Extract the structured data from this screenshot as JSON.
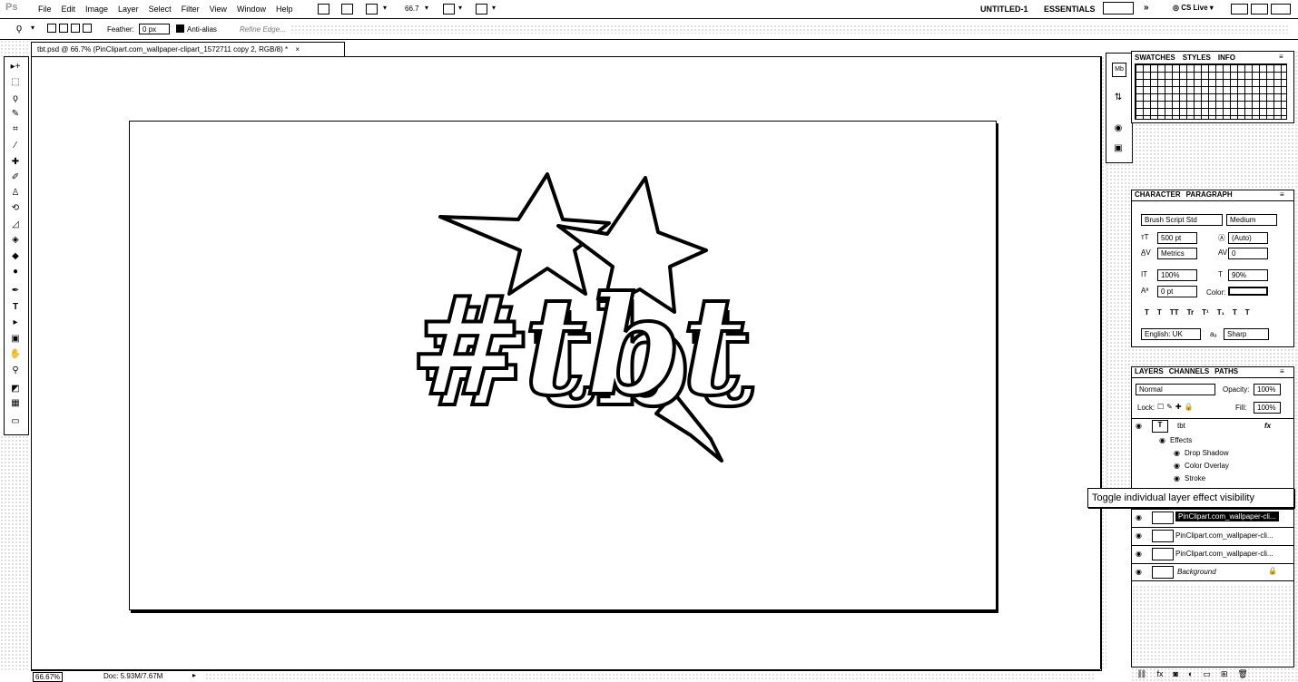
{
  "app": {
    "logo": "Ps",
    "menu": [
      "File",
      "Edit",
      "Image",
      "Layer",
      "Select",
      "Filter",
      "View",
      "Window",
      "Help"
    ],
    "zoom_display": "66.7",
    "workspace_doc": "UNTITLED-1",
    "workspace": "ESSENTIALS",
    "cs_live": "CS Live"
  },
  "options": {
    "feather_label": "Feather:",
    "feather_value": "0 px",
    "antialias_label": "Anti-alias",
    "refine_edge": "Refine Edge..."
  },
  "document": {
    "tab_title": "tbt.psd @ 66.7% (PinClipart.com_wallpaper-clipart_1572711 copy 2, RGB/8) *",
    "tab_close": "×",
    "status_zoom": "66.67%",
    "status_doc": "Doc: 5.93M/7.67M",
    "artwork_text": "#tbt"
  },
  "swatches_panel": {
    "tabs": [
      "SWATCHES",
      "STYLES",
      "INFO"
    ]
  },
  "character_panel": {
    "tabs": [
      "CHARACTER",
      "PARAGRAPH"
    ],
    "font_family": "Brush Script Std",
    "font_style": "Medium",
    "font_size": "500 pt",
    "leading": "(Auto)",
    "kerning": "Metrics",
    "tracking": "0",
    "vertical_scale": "100%",
    "horizontal_scale": "90%",
    "baseline_shift": "0 pt",
    "color_label": "Color:",
    "type_style_buttons": [
      "T",
      "T",
      "TT",
      "Tr",
      "T¹",
      "T₁",
      "T",
      "T"
    ],
    "language": "English: UK",
    "aa_label": "aₐ",
    "antialias": "Sharp"
  },
  "layers_panel": {
    "tabs": [
      "LAYERS",
      "CHANNELS",
      "PATHS"
    ],
    "blend_mode": "Normal",
    "opacity_label": "Opacity:",
    "opacity": "100%",
    "lock_label": "Lock:",
    "fill_label": "Fill:",
    "fill": "100%",
    "layers": [
      {
        "name": "tbt",
        "type": "text",
        "fx": "fx"
      },
      {
        "name": "Effects",
        "type": "effects-header"
      },
      {
        "name": "Drop Shadow",
        "type": "effect"
      },
      {
        "name": "Color Overlay",
        "type": "effect"
      },
      {
        "name": "Stroke",
        "type": "effect"
      },
      {
        "name": "PinClipart.com_wallpaper-cli...",
        "type": "image",
        "selected": true
      },
      {
        "name": "PinClipart.com_wallpaper-cli...",
        "type": "image"
      },
      {
        "name": "PinClipart.com_wallpaper-cli...",
        "type": "image"
      },
      {
        "name": "Background",
        "type": "background"
      }
    ]
  },
  "tooltip": {
    "text": "Toggle individual layer effect visibility"
  },
  "colors": {
    "ink": "#000000",
    "paper": "#ffffff",
    "selection": "#000000"
  }
}
